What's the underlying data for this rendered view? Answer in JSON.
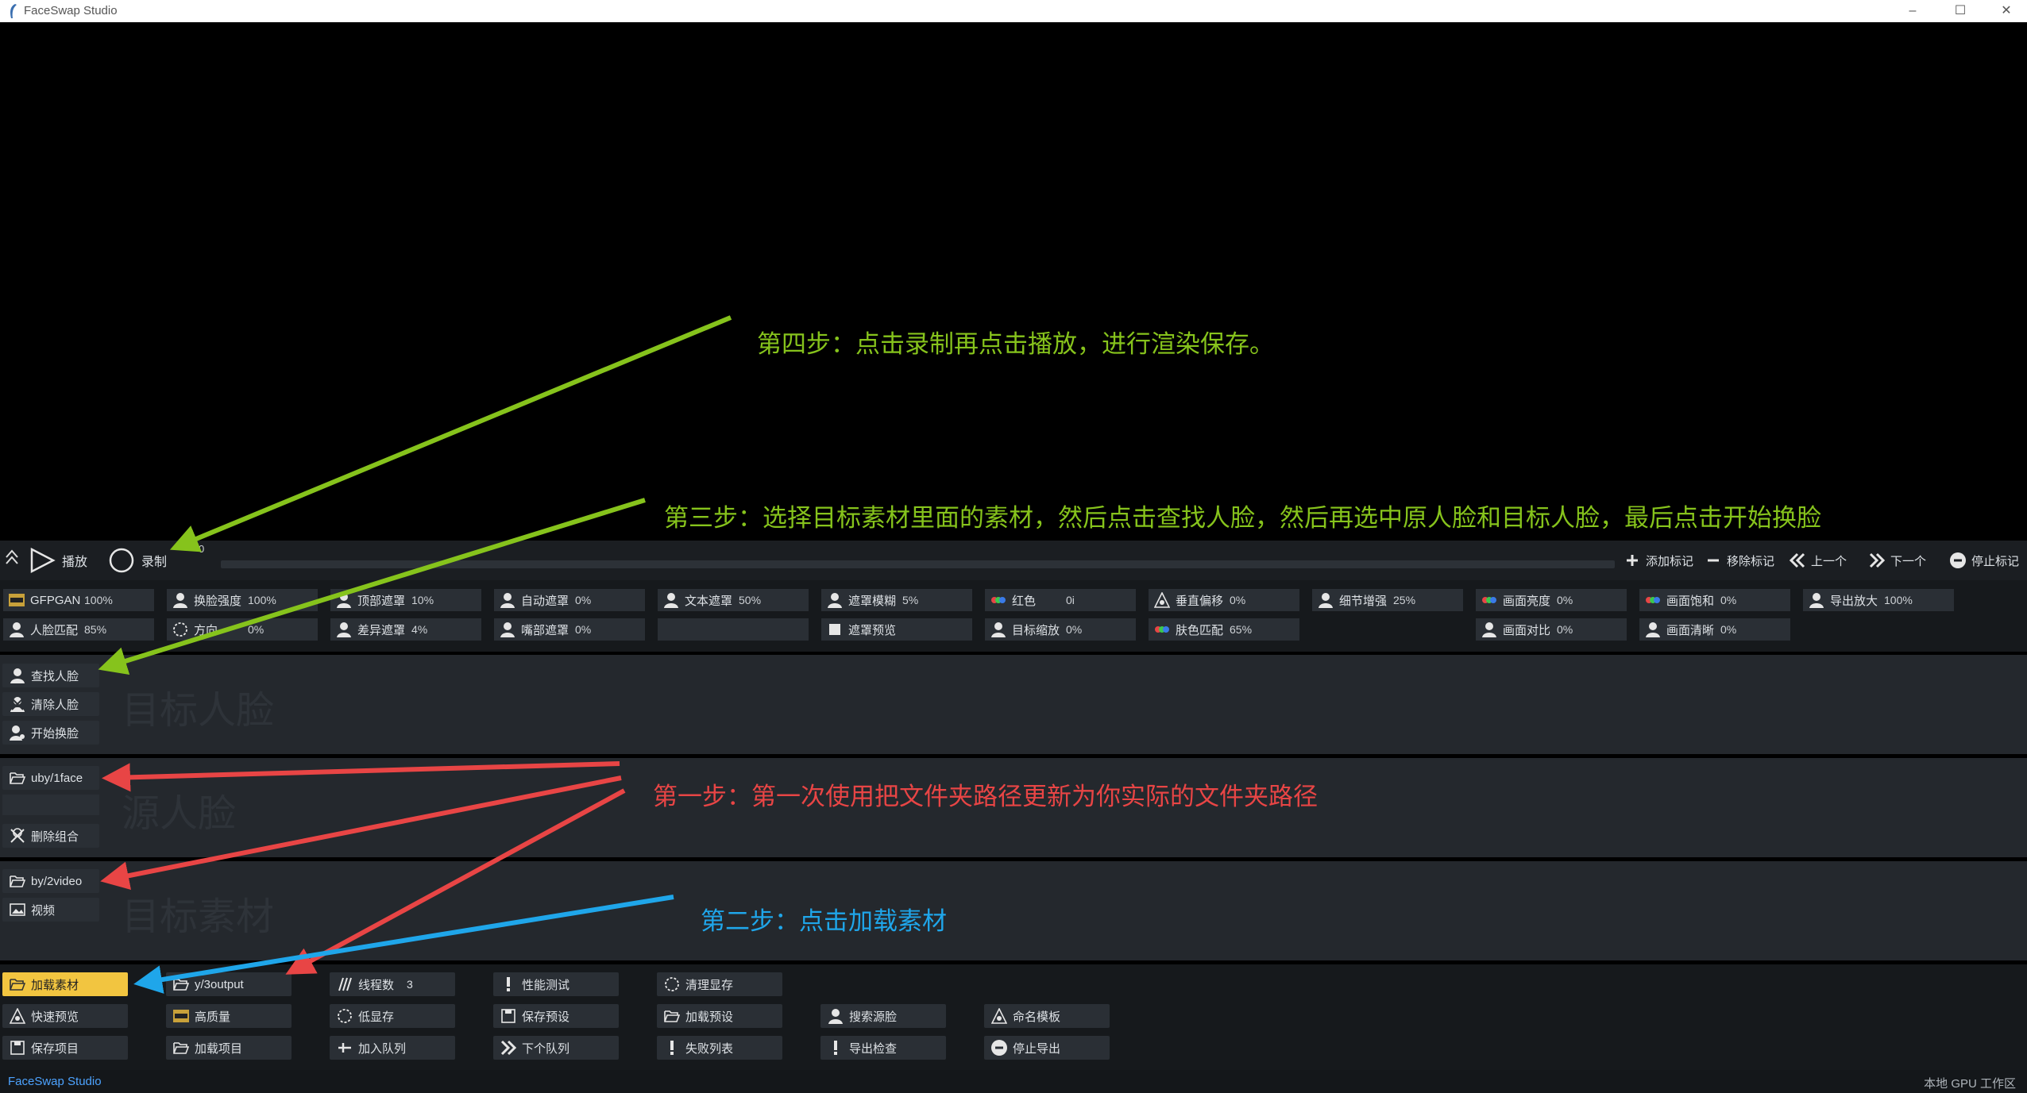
{
  "window": {
    "title": "FaceSwap Studio",
    "minimize": "–",
    "maximize": "☐",
    "close": "✕"
  },
  "playbar": {
    "play_label": "播放",
    "record_label": "录制",
    "frame_number": "0",
    "add_marker": "添加标记",
    "remove_marker": "移除标记",
    "prev": "上一个",
    "next": "下一个",
    "stop_marker": "停止标记"
  },
  "controls": {
    "row1": [
      {
        "label": "GFPGAN",
        "value": "100%",
        "icon": "gfpgan-icon"
      },
      {
        "label": "换脸强度",
        "value": "100%",
        "icon": "swap-strength-icon"
      },
      {
        "label": "顶部遮罩",
        "value": "10%",
        "icon": "top-mask-icon"
      },
      {
        "label": "自动遮罩",
        "value": "0%",
        "icon": "auto-mask-icon"
      },
      {
        "label": "文本遮罩",
        "value": "50%",
        "icon": "text-mask-icon"
      },
      {
        "label": "遮罩模糊",
        "value": "5%",
        "icon": "mask-blur-icon"
      },
      {
        "label": "红色",
        "value": "0i",
        "icon": "color-icon"
      },
      {
        "label": "垂直偏移",
        "value": "0%",
        "icon": "vertical-offset-icon"
      },
      {
        "label": "细节增强",
        "value": "25%",
        "icon": "detail-enhance-icon"
      },
      {
        "label": "画面亮度",
        "value": "0%",
        "icon": "brightness-icon"
      },
      {
        "label": "画面饱和",
        "value": "0%",
        "icon": "saturation-icon"
      },
      {
        "label": "导出放大",
        "value": "100%",
        "icon": "export-scale-icon"
      }
    ],
    "row2": [
      {
        "label": "人脸匹配",
        "value": "85%",
        "icon": "face-match-icon"
      },
      {
        "label": "方向",
        "value": "0%",
        "icon": "orientation-icon"
      },
      {
        "label": "差异遮罩",
        "value": "4%",
        "icon": "diff-mask-icon"
      },
      {
        "label": "嘴部遮罩",
        "value": "0%",
        "icon": "mouth-mask-icon"
      },
      {
        "label": "",
        "value": "",
        "icon": ""
      },
      {
        "label": "遮罩预览",
        "value": "",
        "icon": "checkbox-icon"
      },
      {
        "label": "目标缩放",
        "value": "0%",
        "icon": "target-scale-icon"
      },
      {
        "label": "肤色匹配",
        "value": "65%",
        "icon": "skin-match-icon"
      },
      {
        "label": "画面对比",
        "value": "0%",
        "icon": "contrast-icon"
      },
      {
        "label": "画面清晰",
        "value": "0%",
        "icon": "sharpness-icon"
      }
    ]
  },
  "target_faces": {
    "watermark": "目标人脸",
    "find": "查找人脸",
    "clear": "清除人脸",
    "swap": "开始换脸"
  },
  "source_faces": {
    "watermark": "源人脸",
    "folder": "uby/1face",
    "delete_combo": "删除组合"
  },
  "target_media": {
    "watermark": "目标素材",
    "folder": "by/2video",
    "video": "视频"
  },
  "bottom": {
    "load_media": "加载素材",
    "quick_preview": "快速预览",
    "save_project": "保存项目",
    "output_folder": "y/3output",
    "high_quality": "高质量",
    "load_project": "加载项目",
    "threads": "线程数",
    "threads_value": "3",
    "low_vram": "低显存",
    "add_queue": "加入队列",
    "perf_test": "性能测试",
    "save_preset": "保存预设",
    "next_queue": "下个队列",
    "clear_vram": "清理显存",
    "load_preset": "加载预设",
    "fail_list": "失败列表",
    "search_source": "搜索源脸",
    "export_check": "导出检查",
    "name_template": "命名模板",
    "stop_export": "停止导出"
  },
  "annotations": {
    "step4": "第四步：点击录制再点击播放，进行渲染保存。",
    "step3": "第三步：选择目标素材里面的素材，然后点击查找人脸，然后再选中原人脸和目标人脸，最后点击开始换脸",
    "step1": "第一步：第一次使用把文件夹路径更新为你实际的文件夹路径",
    "step2": "第二步：点击加载素材"
  },
  "status": {
    "left": "FaceSwap Studio",
    "right": "本地 GPU 工作区"
  },
  "colors": {
    "green": "#86c31c",
    "red": "#e84545",
    "blue": "#1fa6ea",
    "accent": "#f2c540"
  }
}
